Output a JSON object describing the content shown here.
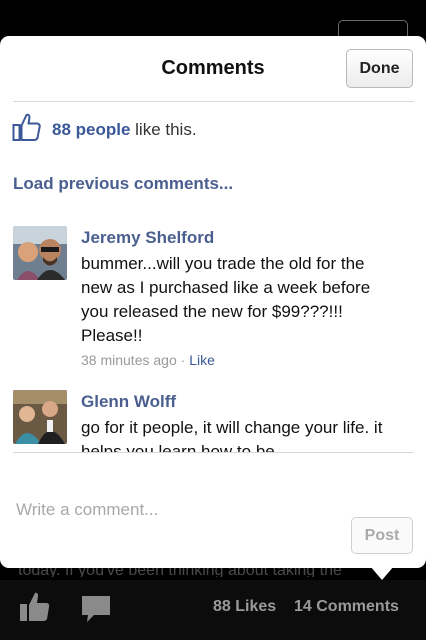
{
  "background": {
    "partial_text": "today. If you've been thinking about taking the"
  },
  "bottom_bar": {
    "likes": "88 Likes",
    "comments": "14 Comments"
  },
  "modal": {
    "title": "Comments",
    "done_label": "Done",
    "like_summary": {
      "count": "88 people",
      "suffix": " like this."
    },
    "load_previous": "Load previous comments...",
    "comments": [
      {
        "name": "Jeremy Shelford",
        "text": "bummer...will you trade the old for the new as I purchased like a week before you released the new for $99???!!!  Please!!",
        "time": "38 minutes ago",
        "separator": " · ",
        "like": "Like"
      },
      {
        "name": "Glenn Wolff",
        "text": "go for it people, it will change your life. it helps you learn how to be"
      }
    ],
    "write_placeholder": "Write a comment...",
    "post_label": "Post"
  },
  "colors": {
    "link_blue": "#3b5998",
    "name_blue": "#4a5f8f",
    "backdrop": "#000000"
  }
}
